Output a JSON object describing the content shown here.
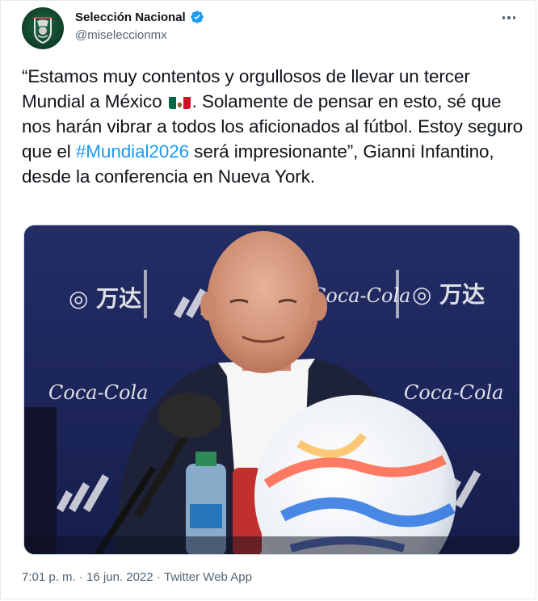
{
  "account": {
    "display_name": "Selección Nacional",
    "handle": "@miseleccionmx",
    "verified_icon": "verified-badge-icon",
    "avatar_icon": "mexico-national-team-crest-icon"
  },
  "tweet": {
    "text_before_hashtag_part1": "“Estamos muy contentos y orgullosos de llevar un tercer Mundial a México",
    "flag_icon": "mexico-flag-icon",
    "text_before_hashtag_part2": ". Solamente de pensar en esto, sé que nos harán vibrar a todos los aficionados al fútbol. Estoy seguro que el ",
    "hashtag": "#Mundial2026",
    "text_after_hashtag": " será impresionante”, Gianni Infantino, desde la conferencia en Nueva York."
  },
  "media": {
    "backdrop_logos": [
      "万达 WANDA",
      "Coca-Cola",
      "adidas"
    ]
  },
  "meta": {
    "time": "7:01 p. m.",
    "separator1": " · ",
    "date": "16 jun. 2022",
    "separator2": " · ",
    "source": "Twitter Web App"
  },
  "colors": {
    "link": "#1d9bf0",
    "secondary_text": "#536471",
    "verified": "#1d9bf0"
  }
}
